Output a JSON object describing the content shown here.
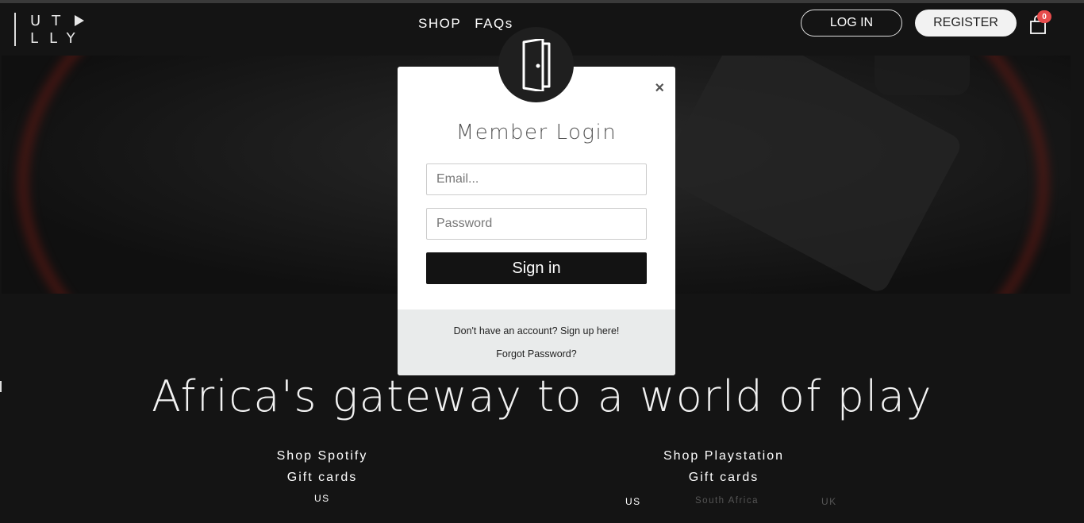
{
  "header": {
    "logo_line1": "UT",
    "logo_line2": "LLY",
    "nav": [
      "SHOP",
      "FAQs"
    ],
    "login_label": "LOG IN",
    "register_label": "REGISTER",
    "cart_count": "0"
  },
  "modal": {
    "title": "Member Login",
    "close": "×",
    "email_placeholder": "Email...",
    "password_placeholder": "Password",
    "signin_label": "Sign in",
    "signup_text": "Don't have an account? Sign up here!",
    "forgot_text": "Forgot Password?"
  },
  "main": {
    "headline": "Africa's gateway to a world of play",
    "shop_spotify": {
      "line1": "Shop Spotify",
      "line2": "Gift cards",
      "regions": [
        "US"
      ]
    },
    "shop_playstation": {
      "line1": "Shop Playstation",
      "line2": "Gift cards",
      "regions": [
        "US",
        "South Africa",
        "UK"
      ]
    }
  },
  "colors": {
    "background": "#141414",
    "badge": "#e74c4c",
    "accent_red": "#6a1a14"
  },
  "icons": [
    "door-icon",
    "close-icon",
    "cart-icon",
    "play-icon"
  ]
}
